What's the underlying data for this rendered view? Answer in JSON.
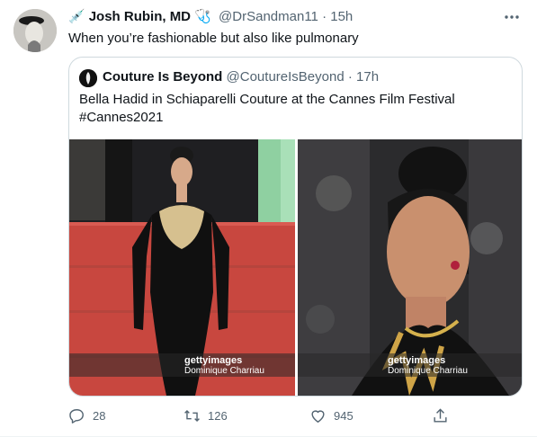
{
  "tweet": {
    "name": "Josh Rubin, MD",
    "prefix_emoji": "💉",
    "suffix_emoji": "🩺",
    "handle": "@DrSandman11",
    "dot": "·",
    "time": "15h",
    "text": "When you’re fashionable but also like pulmonary"
  },
  "quote": {
    "name": "Couture Is Beyond",
    "handle": "@CoutureIsBeyond",
    "dot": "·",
    "time": "17h",
    "text_line1": "Bella Hadid in Schiaparelli Couture at the Cannes Film Festival",
    "text_line2": "#Cannes2021",
    "images": [
      {
        "watermark": "gettyimages",
        "credit": "Dominique Charriau"
      },
      {
        "watermark": "gettyimages",
        "credit": "Dominique Charriau"
      }
    ]
  },
  "actions": {
    "reply_count": "28",
    "retweet_count": "126",
    "like_count": "945"
  },
  "icons": {
    "more": "more-icon",
    "reply": "reply-icon",
    "retweet": "retweet-icon",
    "like": "like-icon",
    "share": "share-icon"
  },
  "colors": {
    "text": "#0f1419",
    "secondary": "#536471",
    "border": "#cfd9de"
  }
}
